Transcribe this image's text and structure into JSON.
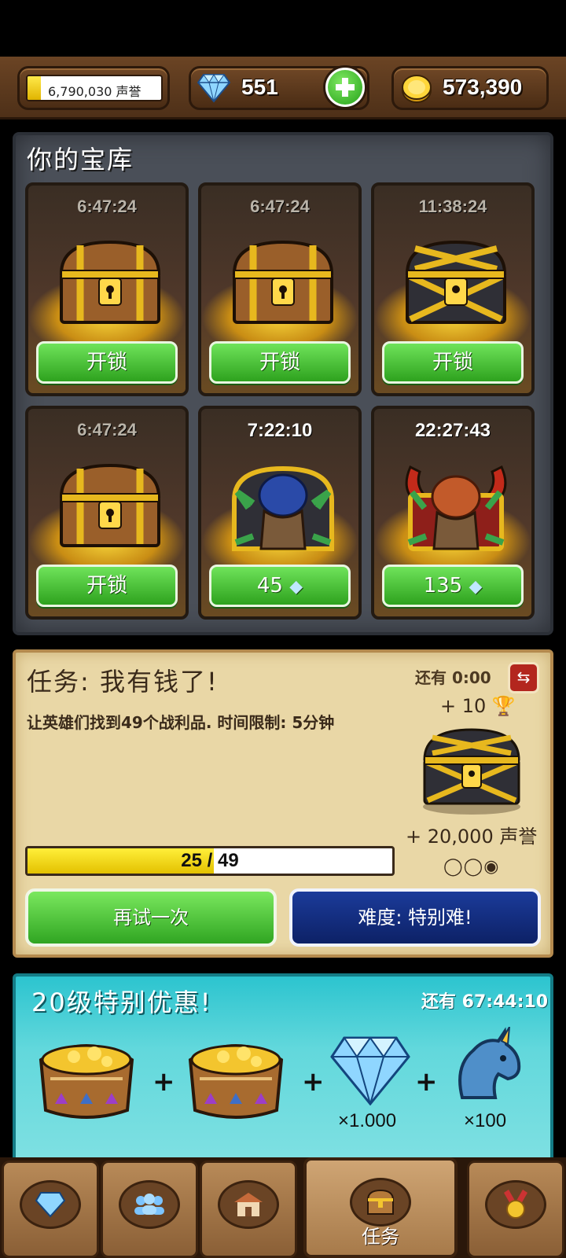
{
  "hud": {
    "reputation": "6,790,030 声誉",
    "reputation_progress": 0.1,
    "gems": "551",
    "gold": "573,390"
  },
  "vault": {
    "title": "你的宝库",
    "chests": [
      {
        "timer": "6:47:24",
        "button": "开锁",
        "type": "wooden"
      },
      {
        "timer": "6:47:24",
        "button": "开锁",
        "type": "wooden"
      },
      {
        "timer": "11:38:24",
        "button": "开锁",
        "type": "gold-lattice"
      },
      {
        "timer": "6:47:24",
        "button": "开锁",
        "type": "wooden"
      },
      {
        "timer": "7:22:10",
        "button": "45",
        "type": "hero-blue"
      },
      {
        "timer": "22:27:43",
        "button": "135",
        "type": "hero-horned"
      }
    ]
  },
  "mission": {
    "title": "任务: 我有钱了!",
    "remaining": "还有 0:00",
    "description": "让英雄们找到49个战利品. 时间限制: 5分钟",
    "reward_trophies": "+ 10",
    "reward_reputation": "+ 20,000 声誉",
    "reward_dots": "◯◯◉",
    "progress_text": "25 / 49",
    "progress_value": 25,
    "progress_max": 49,
    "retry_label": "再试一次",
    "difficulty_label": "难度: 特别难!"
  },
  "offer": {
    "title": "20级特别优惠!",
    "remaining": "还有 67:44:10",
    "gems_qty": "×1.000",
    "unicorn_qty": "×100"
  },
  "nav": {
    "active_label": "任务",
    "tabs": [
      "gems-shop",
      "heroes",
      "buildings",
      "quests",
      "achievements"
    ]
  }
}
